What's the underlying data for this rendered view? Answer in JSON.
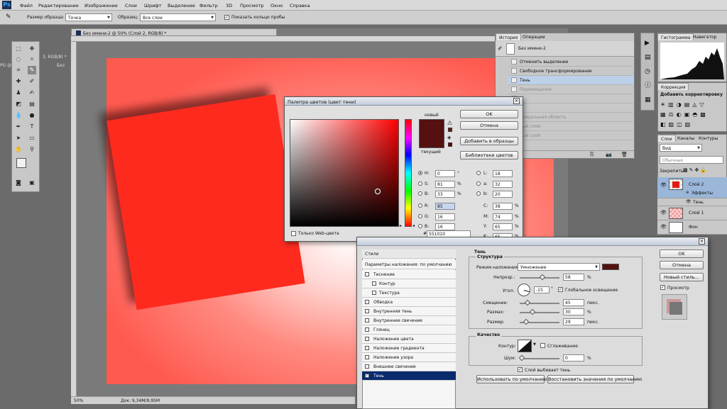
{
  "menubar": {
    "logo": "Ps",
    "items": [
      "Файл",
      "Редактирование",
      "Изображение",
      "Слои",
      "Шрифт",
      "Выделение",
      "Фильтр",
      "3D",
      "Просмотр",
      "Окно",
      "Справка"
    ]
  },
  "options": {
    "sample_size_label": "Размер образца:",
    "sample_size_value": "Точка",
    "sample_label": "Образец:",
    "sample_value": "Все слои",
    "show_ring_label": "Показать кольцо пробы"
  },
  "document": {
    "tab_title": "Без имени-2 @ 50% (Слой 2, RGB/8) *",
    "side_tab_1": "3, RGB/8) *",
    "side_tab_2": "Без",
    "side_tab_3": "PG @",
    "zoom": "50%",
    "doc_info": "Док: 9,34M/9,95M"
  },
  "history": {
    "tabs": [
      "История",
      "Операции"
    ],
    "snapshot": "Без имени-2",
    "items": [
      {
        "label": "Отменить выделение",
        "state": "normal"
      },
      {
        "label": "Свободное трансформирование",
        "state": "normal"
      },
      {
        "label": "Тень",
        "state": "selected"
      },
      {
        "label": "Перемещение",
        "state": "dim"
      },
      {
        "label": "",
        "state": "dim"
      },
      {
        "label": "",
        "state": "dim"
      },
      {
        "label": "имеральная область",
        "state": "dim"
      },
      {
        "label": "ный слой",
        "state": "dim"
      },
      {
        "label": "ный слой",
        "state": "dim"
      }
    ]
  },
  "histogram": {
    "tabs": [
      "Гистограмма",
      "Навигатор"
    ]
  },
  "corrections": {
    "tab": "Коррекция",
    "subtitle": "Добавить корректировку"
  },
  "layers": {
    "tabs": [
      "Слои",
      "Каналы",
      "Контуры"
    ],
    "kind_label": "Вид",
    "blend_mode": "Обычные",
    "lock_label": "Закрепить:",
    "items": [
      {
        "name": "Слой 2",
        "effects_label": "Эффекты",
        "effect": "Тень"
      },
      {
        "name": "Слой 1"
      },
      {
        "name": "Фон"
      }
    ]
  },
  "color_picker": {
    "title": "Палитра цветов (цвет тени)",
    "new_label": "новый",
    "current_label": "текущий",
    "new_color": "#551010",
    "current_color": "#551010",
    "ok": "OK",
    "cancel": "Отмена",
    "add_swatch": "Добавить в образцы",
    "libraries": "Библиотеки цветов",
    "web_only": "Только Web-цвета",
    "fields": {
      "H": "0",
      "S": "81",
      "B": "33",
      "R": "85",
      "G": "16",
      "Bl": "16",
      "L": "18",
      "a": "32",
      "b": "20",
      "C": "38",
      "M": "74",
      "Y": "65",
      "K": "65",
      "hex": "551010"
    },
    "labels": {
      "H": "H:",
      "S": "S:",
      "B": "B:",
      "R": "R:",
      "G": "G:",
      "Bl": "B:",
      "L": "L:",
      "a": "a:",
      "b": "b:",
      "C": "C:",
      "M": "M:",
      "Y": "Y:",
      "K": "K:",
      "hex": "#"
    },
    "units": {
      "deg": "°",
      "pct": "%"
    }
  },
  "layer_style": {
    "styles_header": "Стили",
    "blend_defaults": "Параметры наложения: по умолчанию",
    "style_items": [
      {
        "label": "Тиснение",
        "checked": false,
        "indent": false
      },
      {
        "label": "Контур",
        "checked": false,
        "indent": true
      },
      {
        "label": "Текстура",
        "checked": false,
        "indent": true
      },
      {
        "label": "Обводка",
        "checked": false,
        "indent": false
      },
      {
        "label": "Внутренняя тень",
        "checked": false,
        "indent": false
      },
      {
        "label": "Внутреннее свечение",
        "checked": false,
        "indent": false
      },
      {
        "label": "Глянец",
        "checked": false,
        "indent": false
      },
      {
        "label": "Наложение цвета",
        "checked": false,
        "indent": false
      },
      {
        "label": "Наложение градиента",
        "checked": false,
        "indent": false
      },
      {
        "label": "Наложение узора",
        "checked": false,
        "indent": false
      },
      {
        "label": "Внешнее свечение",
        "checked": false,
        "indent": false
      },
      {
        "label": "Тень",
        "checked": true,
        "indent": false
      }
    ],
    "section_title": "Тень",
    "structure": "Структура",
    "blend_mode_label": "Режим наложения:",
    "blend_mode_value": "Умножение",
    "shadow_color": "#551010",
    "opacity_label": "Непрозр.:",
    "opacity": "58",
    "opacity_frac": 0.58,
    "angle_label": "Угол:",
    "angle": "-15",
    "global_light": "Глобальное освещение",
    "distance_label": "Смещение:",
    "distance": "45",
    "distance_frac": 0.15,
    "spread_label": "Размах:",
    "spread": "30",
    "spread_frac": 0.3,
    "size_label": "Размер:",
    "size": "29",
    "size_frac": 0.12,
    "px": "пикс.",
    "pct": "%",
    "quality": "Качество",
    "contour_label": "Контур:",
    "antialias": "Сглаживание",
    "noise_label": "Шум:",
    "noise": "0",
    "noise_frac": 0,
    "knockout": "Слой выбивает тень",
    "make_default": "Использовать по умолчанию",
    "reset_default": "Восстановить значения по умолчанию",
    "ok": "OK",
    "cancel": "Отмена",
    "new_style": "Новый стиль...",
    "preview": "Просмотр"
  }
}
